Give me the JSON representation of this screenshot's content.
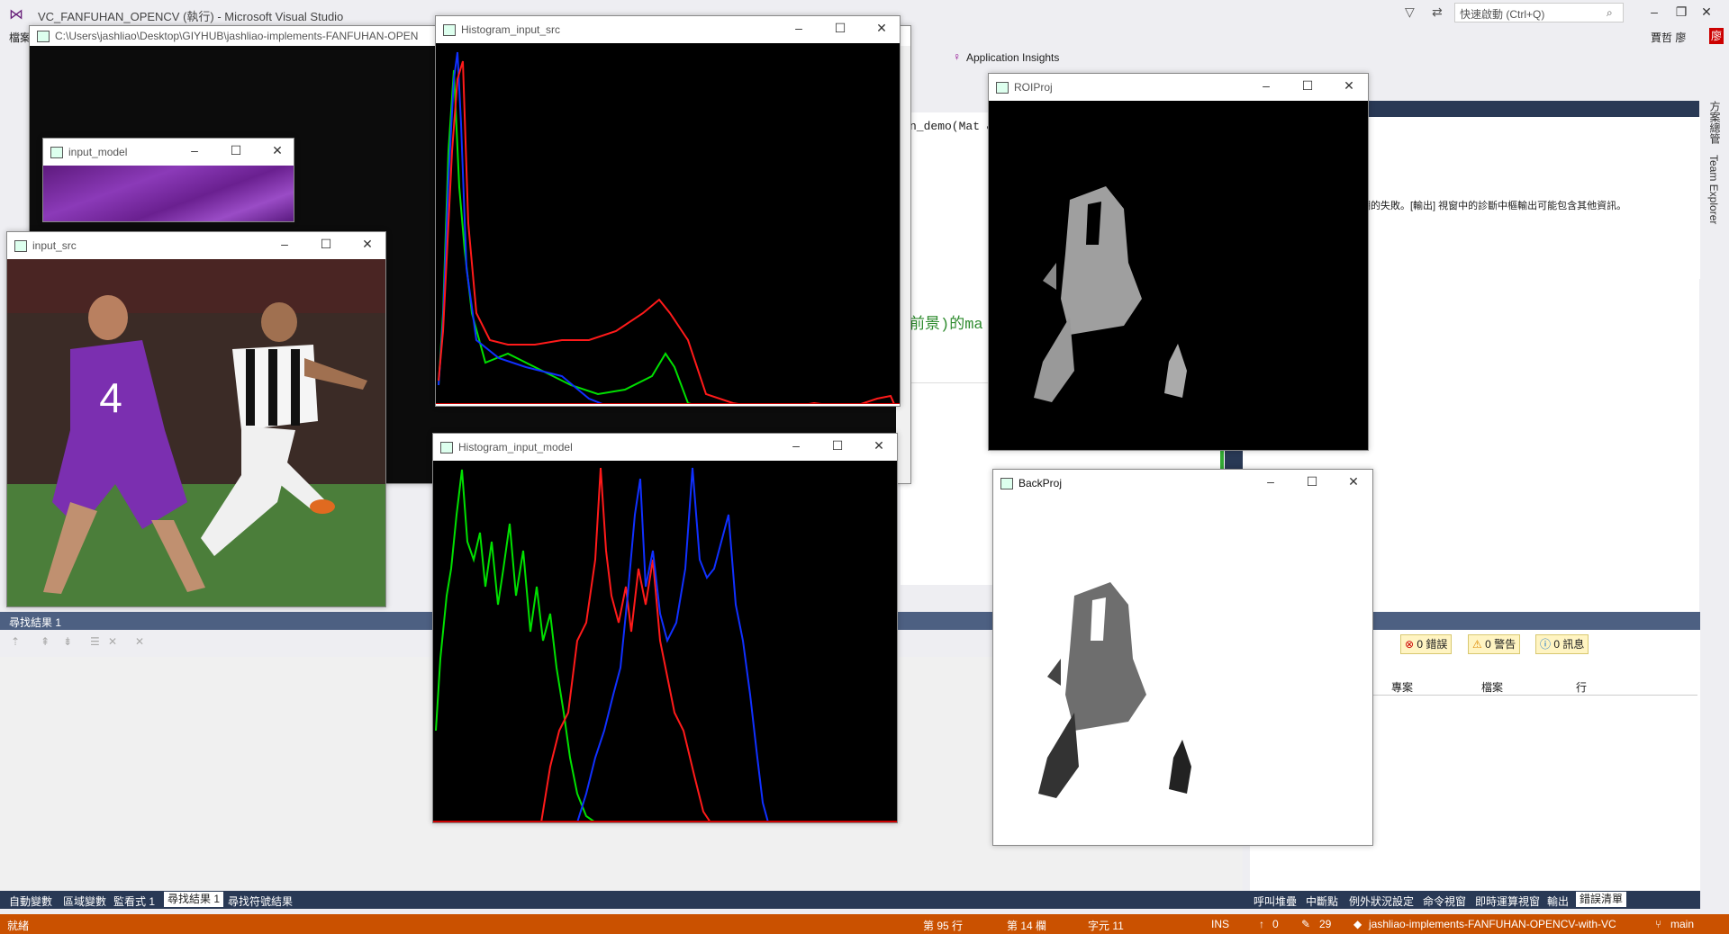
{
  "vs": {
    "title": "VC_FANFUHAN_OPENCV (執行) - Microsoft Visual Studio",
    "quick_launch": "快速啟動 (Ctrl+Q)",
    "user": "賈哲 廖",
    "menu_first": "檔案",
    "app_insights": "Application Insights",
    "editor_fn": "n_demo(Mat &",
    "editor_comment": "前景)的ma",
    "right_panel_msg": "期的失敗。[輸出] 視窗中的診斷中樞輸出可能包含其他資訊。",
    "strip_1": "方案總管",
    "strip_2": "Team Explorer"
  },
  "console": {
    "path": "C:\\Users\\jashliao\\Desktop\\GIYHUB\\jashliao-implements-FANFUHAN-OPEN"
  },
  "find_results": {
    "tab": "尋找結果 1"
  },
  "bottom_tabs": [
    "自動變數",
    "區域變數",
    "監看式 1",
    "尋找結果 1",
    "尋找符號結果"
  ],
  "right_bottom_tabs": [
    "呼叫堆疊",
    "中斷點",
    "例外狀況設定",
    "命令視窗",
    "即時運算視窗",
    "輸出",
    "錯誤清單"
  ],
  "error_list": {
    "errors": "0 錯誤",
    "warnings": "0 警告",
    "messages": "0 訊息",
    "col_project": "專案",
    "col_file": "檔案",
    "col_line": "行"
  },
  "status": {
    "ready": "就緒",
    "line": "第 95 行",
    "col": "第 14 欄",
    "ch": "字元 11",
    "ins": "INS",
    "up": "0",
    "edits": "29",
    "repo": "jashliao-implements-FANFUHAN-OPENCV-with-VC",
    "branch": "main"
  },
  "windows": {
    "input_model": "input_model",
    "input_src": "input_src",
    "hist_src": "Histogram_input_src",
    "hist_model": "Histogram_input_model",
    "roi": "ROIProj",
    "backproj": "BackProj"
  },
  "colors": {
    "status_orange": "#ca5100",
    "vs_blue": "#293955",
    "accent": "#4d6082",
    "purple": "#7a2fa8"
  }
}
